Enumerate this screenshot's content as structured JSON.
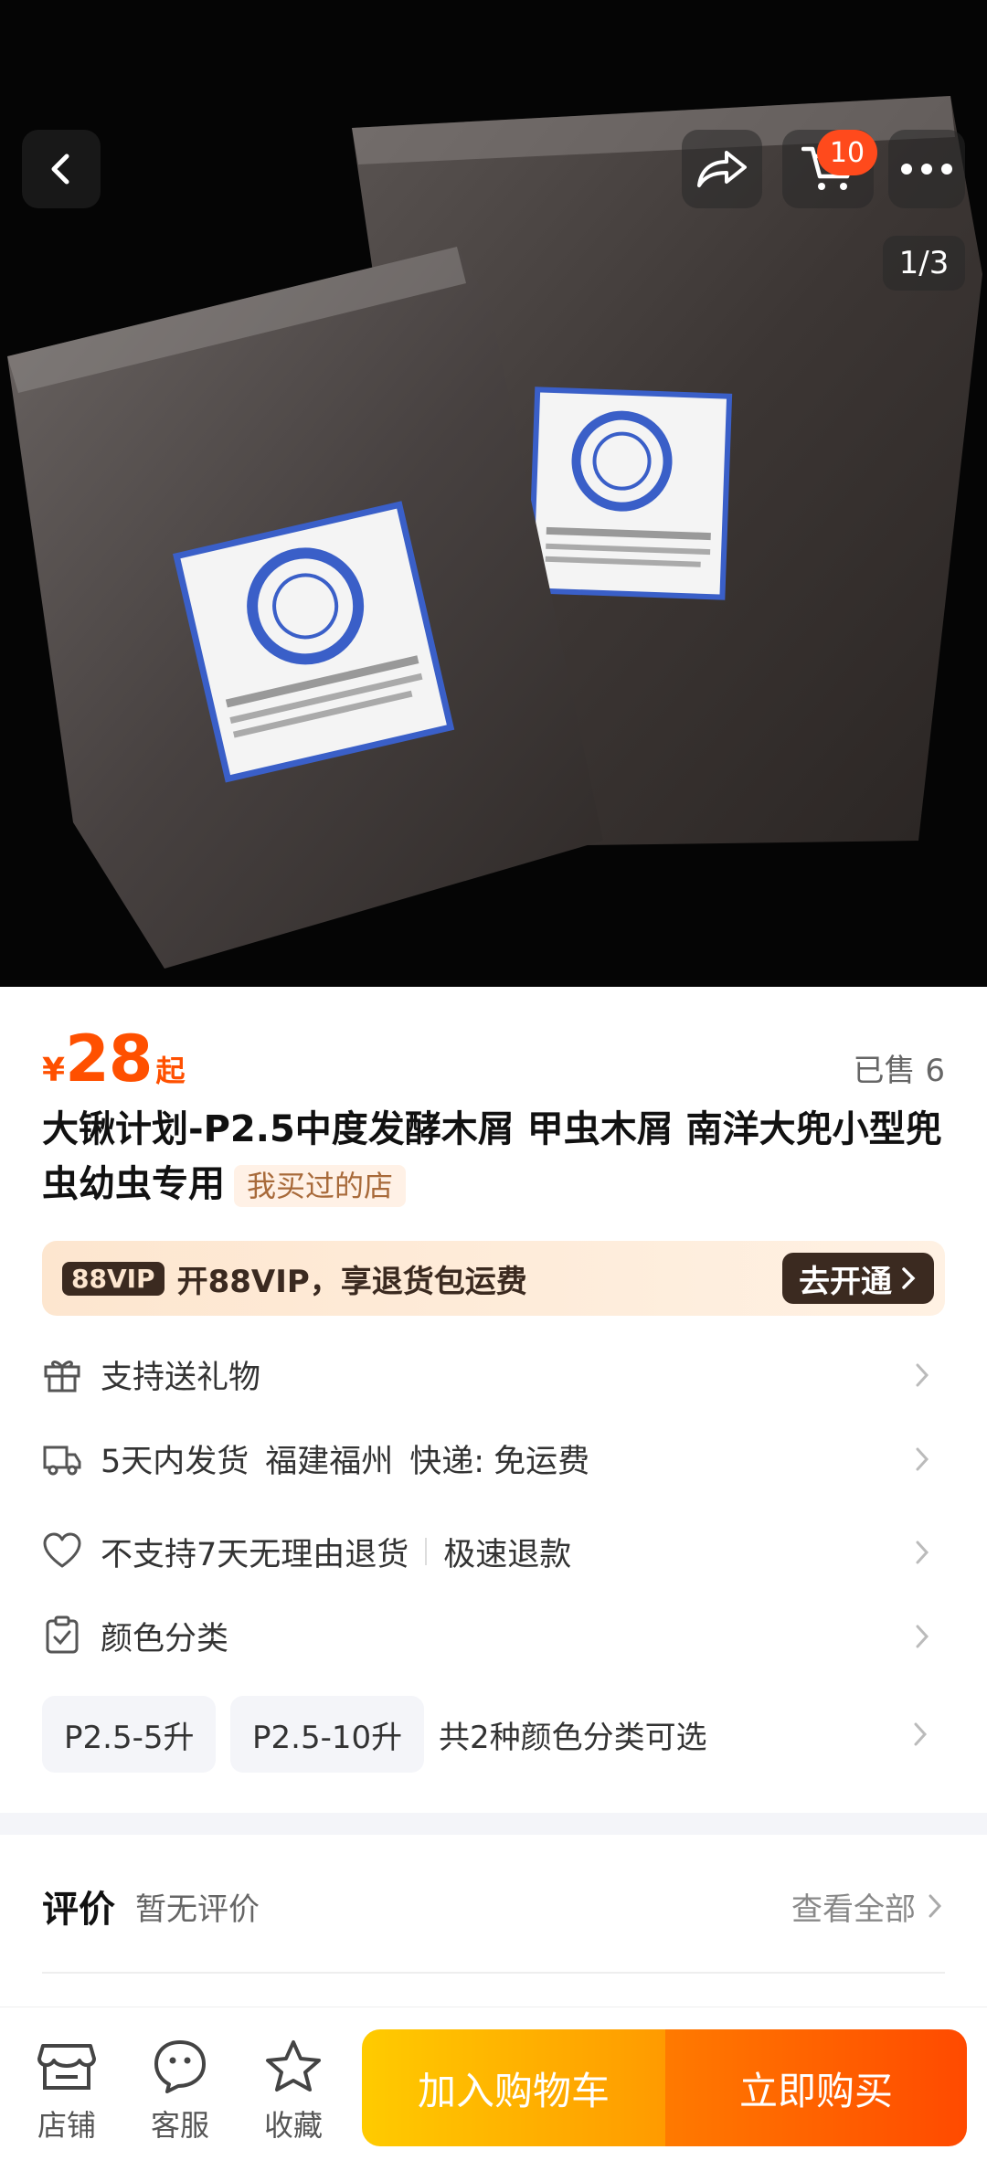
{
  "header": {
    "cart_count": "10",
    "image_counter": "1/3"
  },
  "product": {
    "price_symbol": "¥",
    "price": "28",
    "price_suffix": "起",
    "sold": "已售 6",
    "title": "大锹计划-P2.5中度发酵木屑 甲虫木屑 南洋大兜小型兜虫幼虫专用",
    "shop_tag": "我买过的店"
  },
  "vip": {
    "logo": "88VIP",
    "text": "开88VIP，享退货包运费",
    "button": "去开通"
  },
  "services": {
    "gift": "支持送礼物",
    "shipping": "5天内发货",
    "location": "福建福州",
    "express_label": "快递:",
    "express_value": "免运费",
    "return_policy": "不支持7天无理由退货",
    "refund": "极速退款",
    "color_category": "颜色分类"
  },
  "options": {
    "items": [
      "P2.5-5升",
      "P2.5-10升"
    ],
    "summary": "共2种颜色分类可选"
  },
  "reviews": {
    "title": "评价",
    "status": "暂无评价",
    "view_all": "查看全部"
  },
  "bottom_bar": {
    "shop": "店铺",
    "service": "客服",
    "favorite": "收藏",
    "add_to_cart": "加入购物车",
    "buy_now": "立即购买"
  },
  "colors": {
    "accent": "#ff5000",
    "cart_button": "#ffb300",
    "buy_button": "#ff5a00"
  }
}
